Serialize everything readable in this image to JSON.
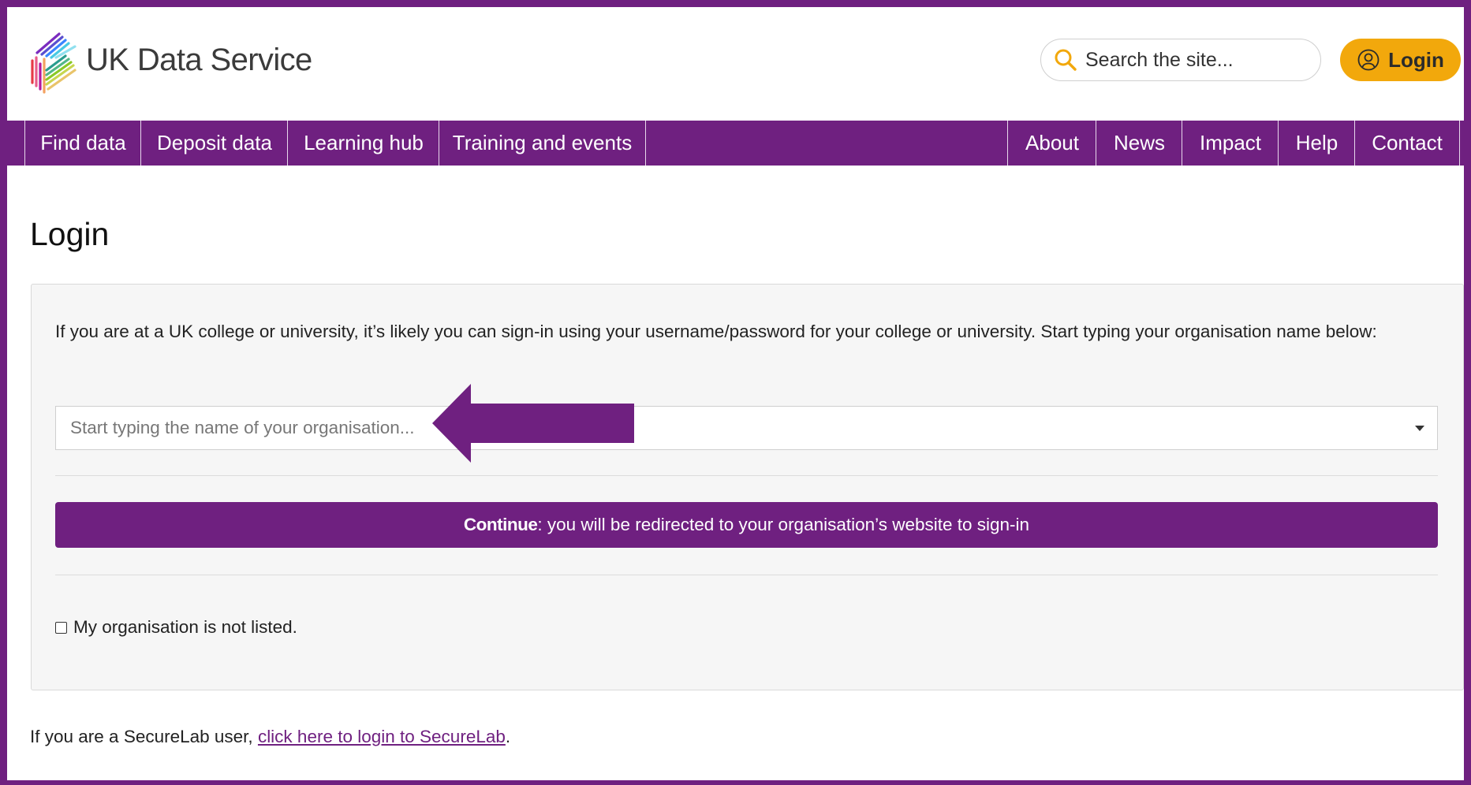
{
  "header": {
    "logo_text": "UK Data Service",
    "search_placeholder": "Search the site...",
    "login_label": "Login"
  },
  "nav": {
    "left": [
      {
        "label": "Find data",
        "name": "nav-find-data"
      },
      {
        "label": "Deposit data",
        "name": "nav-deposit-data"
      },
      {
        "label": "Learning hub",
        "name": "nav-learning-hub"
      },
      {
        "label": "Training and events",
        "name": "nav-training-events"
      }
    ],
    "right": [
      {
        "label": "About",
        "name": "nav-about"
      },
      {
        "label": "News",
        "name": "nav-news"
      },
      {
        "label": "Impact",
        "name": "nav-impact"
      },
      {
        "label": "Help",
        "name": "nav-help"
      },
      {
        "label": "Contact",
        "name": "nav-contact"
      }
    ]
  },
  "main": {
    "title": "Login",
    "intro": "If you are at a UK college or university, it’s likely you can sign-in using your username/password for your college or university. Start typing your organisation name below:",
    "org_select_placeholder": "Start typing the name of your organisation...",
    "continue_bold": "Continue",
    "continue_rest": ": you will be redirected to your organisation’s website to sign-in",
    "not_listed_label": "My organisation is not listed.",
    "securelab_prefix": "If you are a SecureLab user, ",
    "securelab_link": "click here to login to SecureLab",
    "securelab_suffix": "."
  },
  "colors": {
    "brand_purple": "#6f2080",
    "login_orange": "#f2a80c",
    "panel_bg": "#f6f6f6"
  },
  "icons": {
    "logo": "uk-data-service-logo-icon",
    "search": "search-icon",
    "login": "user-circle-icon",
    "select": "caret-down-icon",
    "annotation": "left-arrow-annotation-icon"
  }
}
